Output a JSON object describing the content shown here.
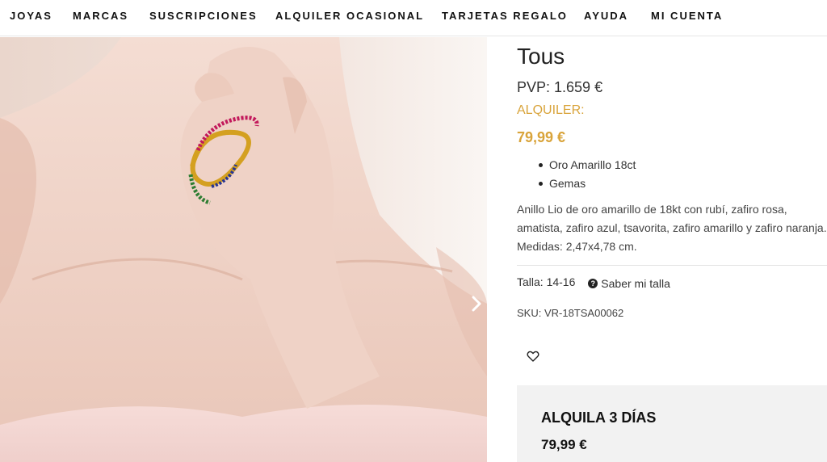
{
  "nav": {
    "items": [
      "JOYAS",
      "MARCAS",
      "SUSCRIPCIONES",
      "ALQUILER OCASIONAL",
      "TARJETAS REGALO",
      "AYUDA",
      "MI CUENTA"
    ]
  },
  "gallery": {
    "image_alt": "",
    "next_icon": "chevron-right-icon"
  },
  "product": {
    "brand": "Tous",
    "pvp": "PVP: 1.659 €",
    "rent_label": "ALQUILER:",
    "rent_price": "79,99 €",
    "features": [
      "Oro Amarillo 18ct",
      "Gemas"
    ],
    "description": "Anillo Lio de oro amarillo de 18kt con rubí, zafiro rosa, amatista, zafiro azul, tsavorita, zafiro amarillo y zafiro naranja. Medidas: 2,47x4,78 cm.",
    "size": "Talla: 14-16",
    "size_guide": "Saber mi talla",
    "sku": "SKU: VR-18TSA00062",
    "wishlist_icon": "heart-icon"
  },
  "rent_box": {
    "title": "ALQUILA 3 DÍAS",
    "price": "79,99 €"
  },
  "colors": {
    "accent": "#d9a43b",
    "text": "#222222",
    "box_bg": "#f2f2f2"
  }
}
